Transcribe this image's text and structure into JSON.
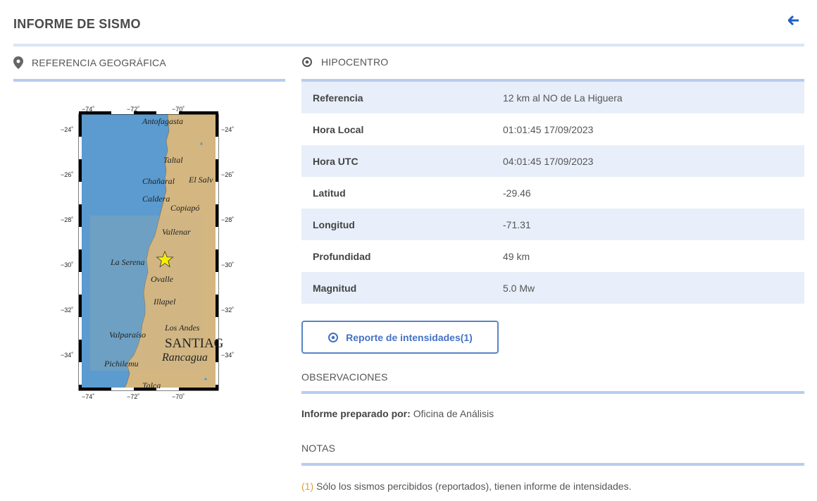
{
  "page": {
    "title": "INFORME DE SISMO"
  },
  "geo": {
    "heading": "REFERENCIA GEOGRÁFICA",
    "map": {
      "lon_ticks": [
        "−74˚",
        "−72˚",
        "−70˚"
      ],
      "lat_ticks": [
        "−24˚",
        "−26˚",
        "−28˚",
        "−30˚",
        "−32˚",
        "−34˚"
      ],
      "places": [
        "Antofagasta",
        "Taltal",
        "Chañaral",
        "El Salv",
        "Caldera",
        "Copiapó",
        "Vallenar",
        "La Serena",
        "Ovalle",
        "Illapel",
        "Los Andes",
        "Valparaíso",
        "SANTIAG",
        "Rancagua",
        "Pichilemu",
        "Talca"
      ],
      "epicenter": {
        "lat": -29.46,
        "lon": -71.31
      }
    }
  },
  "hypocentre": {
    "heading": "HIPOCENTRO",
    "rows": [
      {
        "label": "Referencia",
        "value": "12 km al NO de La Higuera"
      },
      {
        "label": "Hora Local",
        "value": "01:01:45 17/09/2023"
      },
      {
        "label": "Hora UTC",
        "value": "04:01:45 17/09/2023"
      },
      {
        "label": "Latitud",
        "value": "-29.46"
      },
      {
        "label": "Longitud",
        "value": "-71.31"
      },
      {
        "label": "Profundidad",
        "value": "49 km"
      },
      {
        "label": "Magnitud",
        "value": "5.0 Mw"
      }
    ]
  },
  "report_button": {
    "label": "Reporte de intensidades(1)"
  },
  "observations": {
    "heading": "OBSERVACIONES",
    "prepared_label": "Informe preparado por:",
    "prepared_value": "Oficina de Análisis"
  },
  "notes": {
    "heading": "NOTAS",
    "mark": "(1)",
    "text": "Sólo los sismos percibidos (reportados), tienen informe de intensidades."
  },
  "colors": {
    "accent": "#4472c4",
    "rule": "#b7cdee",
    "row": "#e8effa",
    "ocean": "#5b9bd0",
    "land": "#d4b680",
    "star": "#f5f000"
  }
}
